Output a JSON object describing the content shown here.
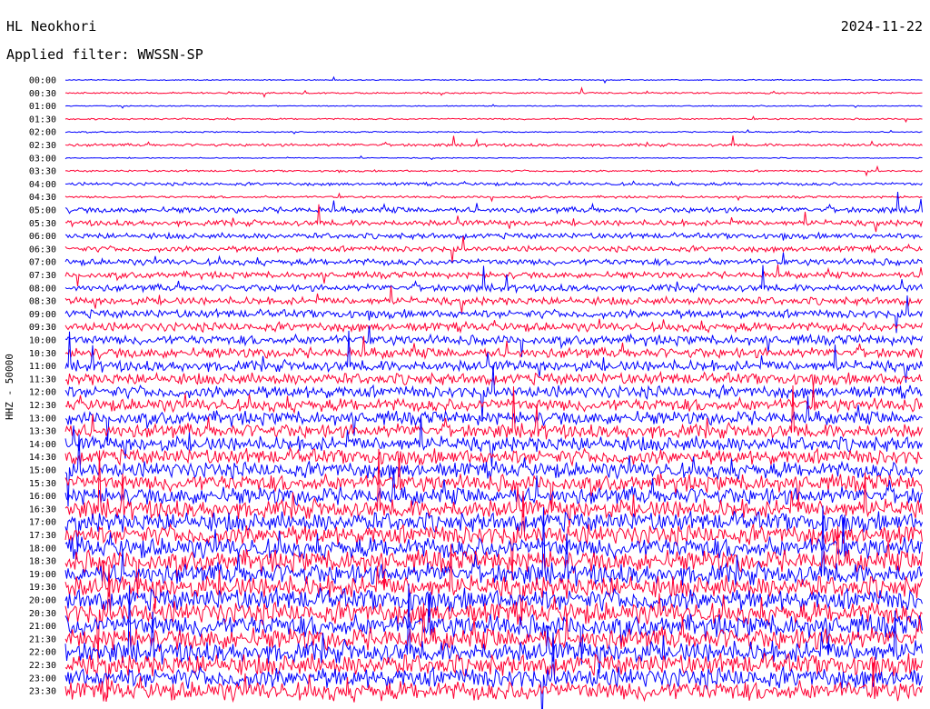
{
  "header": {
    "station": "HL Neokhori",
    "date": "2024-11-22",
    "filter": "Applied filter: WWSSN-SP"
  },
  "axis": {
    "ylabel": "HHZ - 50000"
  },
  "chart_data": {
    "type": "line",
    "title": "HL Neokhori",
    "subtitle": "Applied filter: WWSSN-SP",
    "ylabel": "HHZ - 50000",
    "row_labels": [
      "00:00",
      "00:30",
      "01:00",
      "01:30",
      "02:00",
      "02:30",
      "03:00",
      "03:30",
      "04:00",
      "04:30",
      "05:00",
      "05:30",
      "06:00",
      "06:30",
      "07:00",
      "07:30",
      "08:00",
      "08:30",
      "09:00",
      "09:30",
      "10:00",
      "10:30",
      "11:00",
      "11:30",
      "12:00",
      "12:30",
      "13:00",
      "13:30",
      "14:00",
      "14:30",
      "15:00",
      "15:30",
      "16:00",
      "16:30",
      "17:00",
      "17:30",
      "18:00",
      "18:30",
      "19:00",
      "19:30",
      "20:00",
      "20:30",
      "21:00",
      "21:30",
      "22:00",
      "22:30",
      "23:00",
      "23:30"
    ],
    "row_colors": [
      "#0000ff",
      "#ff0033"
    ],
    "relative_amplitude": [
      0.15,
      0.25,
      0.15,
      0.25,
      0.2,
      0.45,
      0.15,
      0.3,
      0.5,
      0.35,
      0.9,
      0.9,
      0.9,
      0.9,
      1.0,
      1.0,
      1.1,
      1.2,
      1.3,
      1.4,
      1.5,
      1.6,
      1.7,
      1.8,
      1.9,
      2.0,
      2.1,
      2.2,
      2.3,
      2.4,
      2.5,
      2.6,
      2.7,
      2.9,
      3.0,
      3.1,
      3.2,
      3.3,
      3.3,
      3.4,
      3.4,
      3.4,
      3.4,
      3.4,
      3.3,
      3.3,
      3.2,
      3.0
    ],
    "grid": false
  }
}
